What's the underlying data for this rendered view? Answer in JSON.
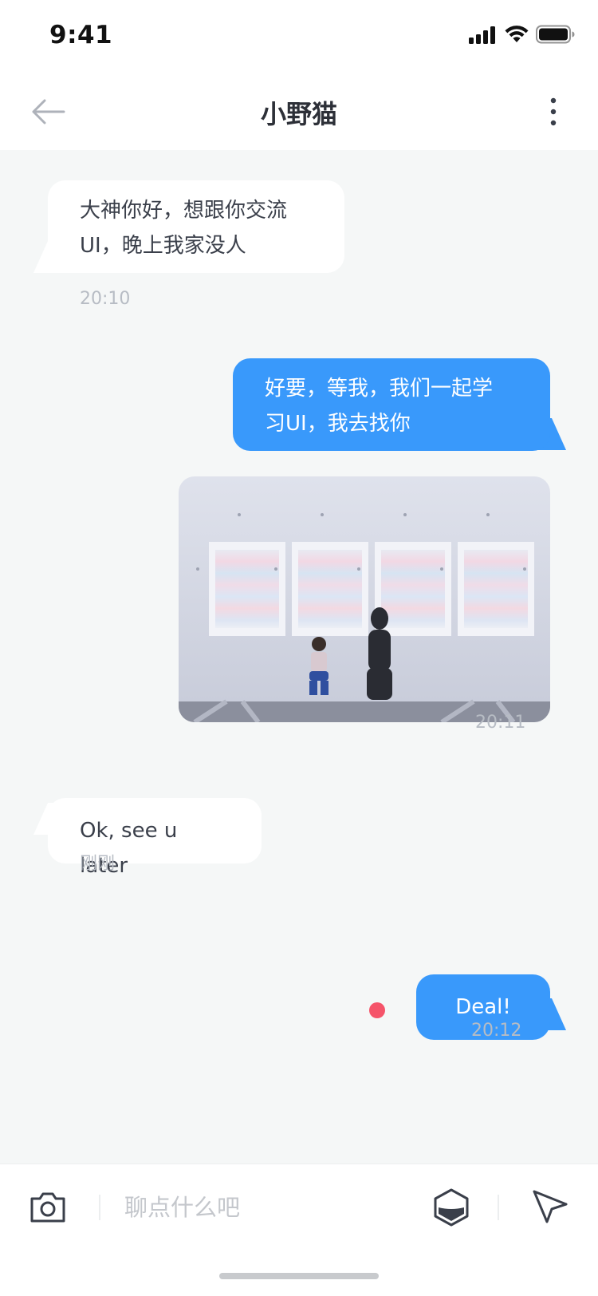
{
  "status_bar": {
    "time": "9:41"
  },
  "nav": {
    "title": "小野猫",
    "back_icon": "arrow-left-icon",
    "more_icon": "more-vertical-icon"
  },
  "messages": [
    {
      "direction": "incoming",
      "lines": [
        "大神你好，想跟你交流",
        "UI，晚上我家没人"
      ],
      "time": "20:10"
    },
    {
      "direction": "outgoing",
      "lines": [
        "好要，等我，我们一起学",
        "习UI，我去找你"
      ]
    },
    {
      "direction": "outgoing",
      "type": "image",
      "image_desc": "photo",
      "time": "20:11"
    },
    {
      "direction": "incoming",
      "lines": [
        "Ok, see u later"
      ],
      "time": "刚刚"
    },
    {
      "direction": "outgoing",
      "lines": [
        "Deal!"
      ],
      "time": "20:12",
      "unread": true
    }
  ],
  "input": {
    "placeholder": "聊点什么吧",
    "value": "",
    "camera_icon": "camera-icon",
    "emoji_icon": "emoji-icon",
    "send_icon": "send-icon"
  },
  "colors": {
    "outgoing_bubble": "#3999fb",
    "incoming_bubble": "#ffffff",
    "chat_background": "#f5f7f7",
    "unread_dot": "#f5546a",
    "timestamp": "#b7bcc4"
  }
}
